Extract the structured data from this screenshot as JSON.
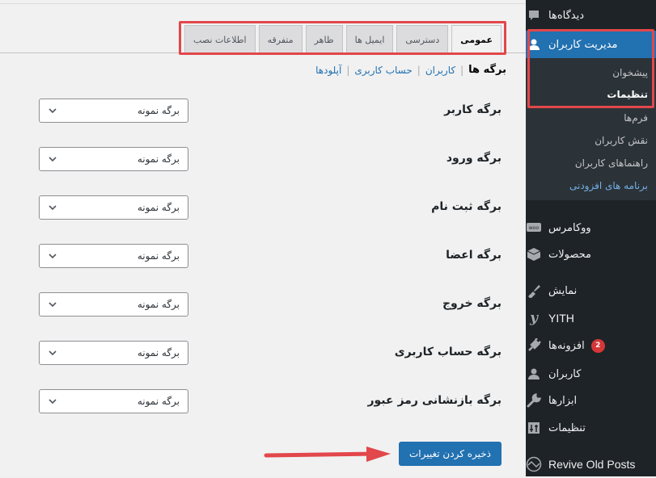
{
  "tabs": [
    {
      "label": "عمومی",
      "active": true
    },
    {
      "label": "دسترسی",
      "active": false
    },
    {
      "label": "ایمیل ها",
      "active": false
    },
    {
      "label": "ظاهر",
      "active": false
    },
    {
      "label": "متفرقه",
      "active": false
    },
    {
      "label": "اطلاعات نصب",
      "active": false
    }
  ],
  "subnav": {
    "current": "برگه ها",
    "links": [
      "کاربران",
      "حساب کاربری",
      "آپلودها"
    ],
    "separator": "|"
  },
  "settings": [
    {
      "label": "برگه کاربر",
      "value": "برگه نمونه"
    },
    {
      "label": "برگه ورود",
      "value": "برگه نمونه"
    },
    {
      "label": "برگه ثبت نام",
      "value": "برگه نمونه"
    },
    {
      "label": "برگه اعضا",
      "value": "برگه نمونه"
    },
    {
      "label": "برگه خروج",
      "value": "برگه نمونه"
    },
    {
      "label": "برگه حساب کاربری",
      "value": "برگه نمونه"
    },
    {
      "label": "برگه بازنشانی رمز عبور",
      "value": "برگه نمونه"
    }
  ],
  "save_label": "ذخیره کردن تغییرات",
  "sidebar": {
    "comments": {
      "label": "دیدگاه‌ها",
      "icon": "comment-icon"
    },
    "user_management": {
      "label": "مدیریت کاربران",
      "icon": "user-icon"
    },
    "submenu": [
      {
        "label": "پیشخوان"
      },
      {
        "label": "تنظیمات"
      },
      {
        "label": "فرم‌ها"
      },
      {
        "label": "نقش کاربران"
      },
      {
        "label": "راهنماهای کاربران"
      },
      {
        "label": "برنامه های افزودنی"
      }
    ],
    "items": [
      {
        "label": "ووکامرس",
        "icon": "woo-icon"
      },
      {
        "label": "محصولات",
        "icon": "box-icon"
      },
      {
        "label": "نمایش",
        "icon": "brush-icon"
      },
      {
        "label": "YITH",
        "icon": "yith-icon"
      },
      {
        "label": "افزونه‌ها",
        "icon": "plugin-icon",
        "badge": "2"
      },
      {
        "label": "کاربران",
        "icon": "user-icon"
      },
      {
        "label": "ابزارها",
        "icon": "wrench-icon"
      },
      {
        "label": "تنظیمات",
        "icon": "settings-icon"
      },
      {
        "label": "Revive Old Posts",
        "icon": "revive-icon"
      }
    ]
  },
  "colors": {
    "accent": "#2271b1",
    "highlight": "#e2474b",
    "sidebar_bg": "#1d2327",
    "badge": "#d63638"
  }
}
